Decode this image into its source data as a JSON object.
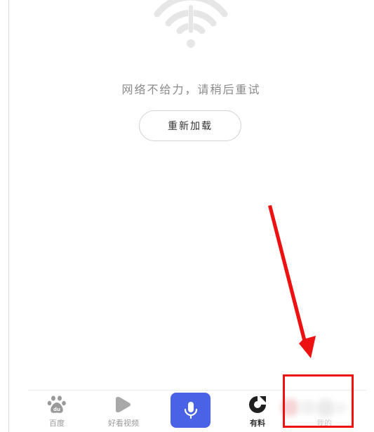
{
  "error": {
    "message": "网络不给力，请稍后重试",
    "icon": "wifi-off-icon"
  },
  "reload": {
    "label": "重新加载"
  },
  "nav": {
    "items": [
      {
        "label": "百度",
        "icon": "baidu-paw-icon"
      },
      {
        "label": "好看视频",
        "icon": "play-icon"
      },
      {
        "label": "",
        "icon": "microphone-icon"
      },
      {
        "label": "有料",
        "icon": "youliao-icon"
      },
      {
        "label": "我的",
        "icon": "avatar-icon"
      }
    ]
  },
  "colors": {
    "voice_button": "#4a62e6",
    "annotation_red": "#ee1111",
    "muted_text": "#8a8a8a",
    "icon_gray": "#9a9a9a"
  }
}
